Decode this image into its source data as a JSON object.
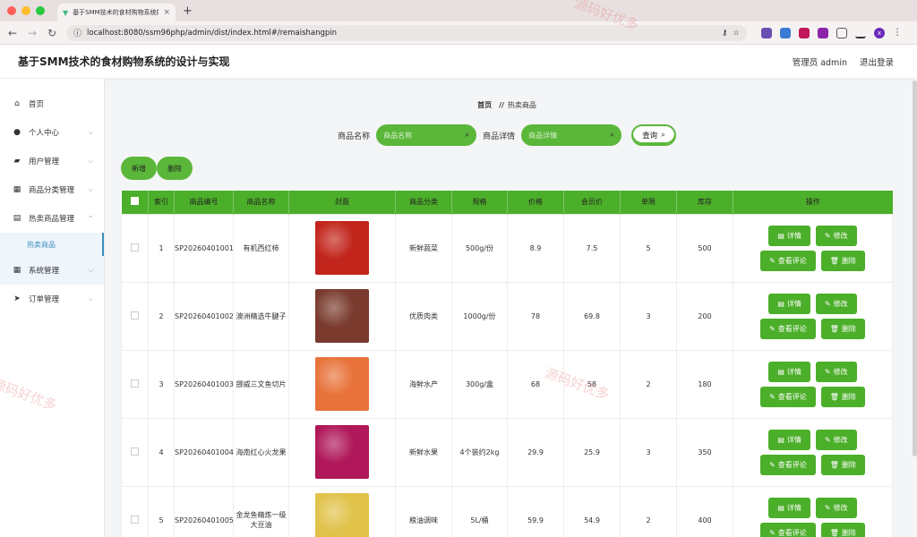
{
  "browser": {
    "tab_title": "基于SMM技术的食材购物系统的",
    "url": "localhost:8080/ssm96php/admin/dist/index.html#/remaishangpin",
    "profile_letter": "x"
  },
  "app": {
    "title": "基于SMM技术的食材购物系统的设计与实现",
    "user_label": "管理员 admin",
    "logout_label": "退出登录"
  },
  "sidebar": {
    "items": [
      {
        "label": "首页",
        "icon": "home-icon",
        "glyph": "⌂"
      },
      {
        "label": "个人中心",
        "icon": "user-icon",
        "glyph": "●"
      },
      {
        "label": "用户管理",
        "icon": "users-icon",
        "glyph": "▰"
      },
      {
        "label": "商品分类管理",
        "icon": "grid-icon",
        "glyph": "▦"
      },
      {
        "label": "热卖商品管理",
        "icon": "clipboard-icon",
        "glyph": "▤"
      },
      {
        "label": "系统管理",
        "icon": "grid-icon",
        "glyph": "▦"
      },
      {
        "label": "订单管理",
        "icon": "send-icon",
        "glyph": "➤"
      }
    ],
    "sub_item": "热卖商品"
  },
  "breadcrumb": {
    "home": "首页",
    "sep": "//",
    "current": "热卖商品"
  },
  "search": {
    "name_label": "商品名称",
    "name_placeholder": "商品名称",
    "detail_label": "商品详情",
    "detail_placeholder": "商品详情",
    "query_label": "查询"
  },
  "actions": {
    "add": "新增",
    "delete": "删除"
  },
  "table": {
    "headers": [
      "",
      "索引",
      "商品编号",
      "商品名称",
      "封面",
      "商品分类",
      "规格",
      "价格",
      "会员价",
      "单限",
      "库存",
      "操作"
    ],
    "op_labels": {
      "detail": "详情",
      "edit": "修改",
      "reviews": "查看评论",
      "delete": "删除"
    },
    "rows": [
      {
        "index": "1",
        "code": "SP20260401001",
        "name": "有机西红柿",
        "category": "新鲜蔬菜",
        "spec": "500g/份",
        "price": "8.9",
        "member_price": "7.5",
        "limit": "5",
        "stock": "500",
        "thumb_color": "#c2251b"
      },
      {
        "index": "2",
        "code": "SP20260401002",
        "name": "澳洲精选牛腱子",
        "category": "优质肉类",
        "spec": "1000g/份",
        "price": "78",
        "member_price": "69.8",
        "limit": "3",
        "stock": "200",
        "thumb_color": "#7a3b2e"
      },
      {
        "index": "3",
        "code": "SP20260401003",
        "name": "挪威三文鱼切片",
        "category": "海鲜水产",
        "spec": "300g/盒",
        "price": "68",
        "member_price": "58",
        "limit": "2",
        "stock": "180",
        "thumb_color": "#e8733a"
      },
      {
        "index": "4",
        "code": "SP20260401004",
        "name": "海南红心火龙果",
        "category": "新鲜水果",
        "spec": "4个装约2kg",
        "price": "29.9",
        "member_price": "25.9",
        "limit": "3",
        "stock": "350",
        "thumb_color": "#b0185a"
      },
      {
        "index": "5",
        "code": "SP20260401005",
        "name": "金龙鱼精炼一级大豆油",
        "category": "粮油调味",
        "spec": "5L/桶",
        "price": "59.9",
        "member_price": "54.9",
        "limit": "2",
        "stock": "400",
        "thumb_color": "#e0c24a"
      }
    ]
  },
  "watermark_text": "源码好优多",
  "colors": {
    "accent": "#4caf2a",
    "search_green": "#5bb73a",
    "link_blue": "#3c8dbc"
  }
}
